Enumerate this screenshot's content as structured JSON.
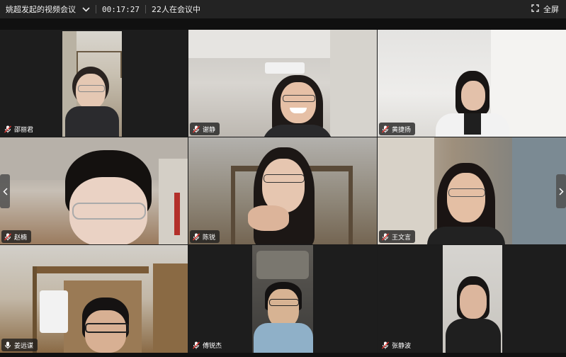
{
  "meeting": {
    "title": "姚超发起的视频会议",
    "elapsed": "00:17:27",
    "participants": "22人在会议中",
    "fullscreen_label": "全屏"
  },
  "tiles": [
    {
      "name": "邵丽君",
      "mic": "muted"
    },
    {
      "name": "谢静",
      "mic": "muted"
    },
    {
      "name": "黄捷扬",
      "mic": "muted"
    },
    {
      "name": "赵楠",
      "mic": "muted"
    },
    {
      "name": "陈锐",
      "mic": "muted"
    },
    {
      "name": "王文言",
      "mic": "muted"
    },
    {
      "name": "姜远谋",
      "mic": "on"
    },
    {
      "name": "傅锐杰",
      "mic": "muted"
    },
    {
      "name": "张静波",
      "mic": "muted"
    }
  ],
  "icons": {
    "mic_muted": "mic-muted-icon",
    "mic_on": "mic-icon",
    "fullscreen": "fullscreen-icon",
    "dropdown": "chevron-down-icon",
    "prev": "chevron-left-icon",
    "next": "chevron-right-icon"
  },
  "colors": {
    "muted_icon": "#e53935",
    "background": "#1b1b1b"
  }
}
